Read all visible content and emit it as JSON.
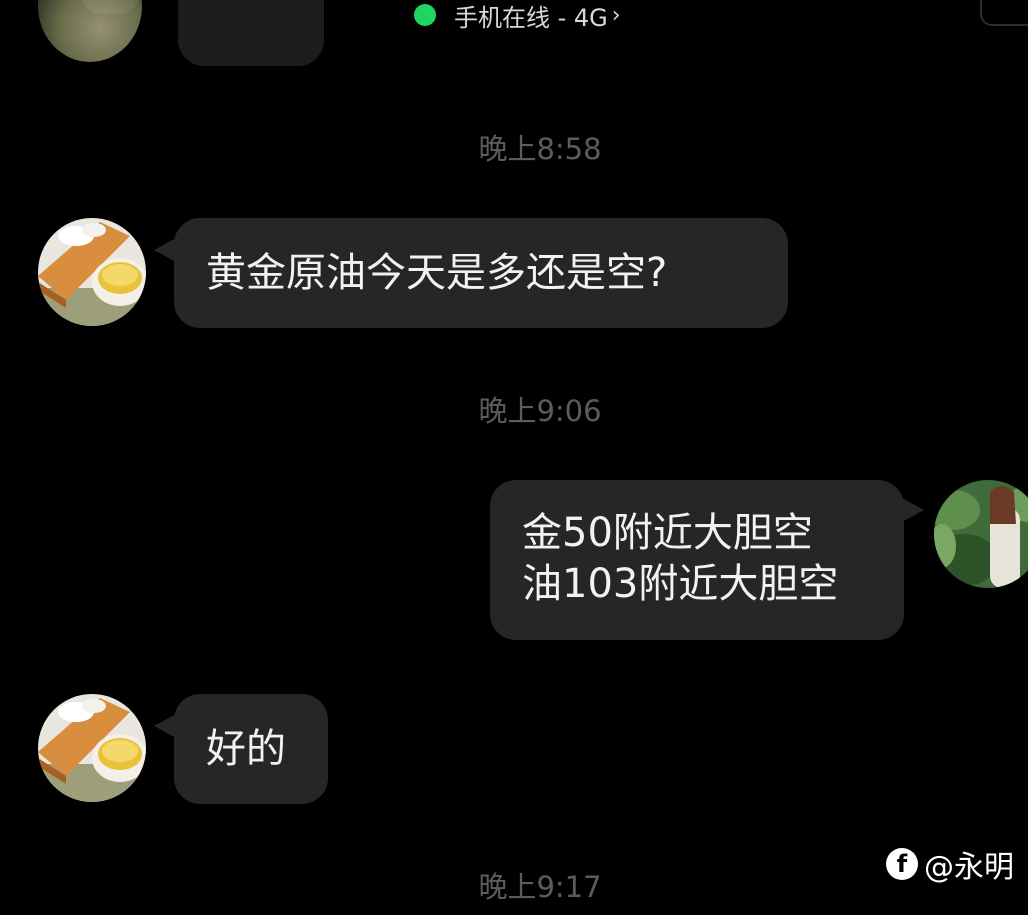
{
  "status_bar": {
    "text": "手机在线 - 4G",
    "chevron": "›",
    "online_color": "#1ed760"
  },
  "messages": [
    {
      "type": "time",
      "text": "晚上8:58"
    },
    {
      "type": "incoming",
      "avatar": "tea-cup-avatar",
      "lines": [
        "黄金原油今天是多还是空?"
      ]
    },
    {
      "type": "time",
      "text": "晚上9:06"
    },
    {
      "type": "outgoing",
      "avatar": "woman-in-garden-avatar",
      "lines": [
        "金50附近大胆空",
        "油103附近大胆空"
      ]
    },
    {
      "type": "incoming",
      "avatar": "tea-cup-avatar",
      "lines": [
        "好的"
      ]
    },
    {
      "type": "time",
      "text": "晚上9:17"
    }
  ],
  "watermark": {
    "icon": "f",
    "text": "@永明"
  },
  "colors": {
    "background": "#000000",
    "bubble": "#262626",
    "timestamp": "#5c5c5c",
    "text": "#f2f2f2"
  }
}
